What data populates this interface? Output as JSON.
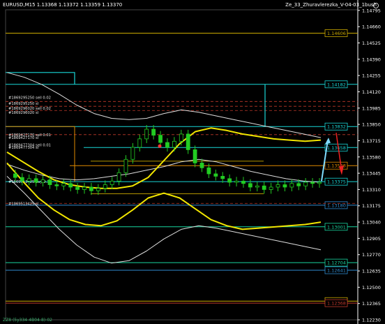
{
  "header": {
    "symbol_line": "EURUSD,M15  1.13368 1.13372 1.13359 1.13370",
    "indicator_name": "Ze_33_Zhuravlerezka_V-04-03_1bush"
  },
  "footer": {
    "text": "ZZ8 (5y334-4B04-8)-02"
  },
  "colors": {
    "background": "#000000",
    "candles": "#22cc22",
    "price_axis": "#ffffff",
    "cyan_level": "#19d7d7",
    "gold_level": "#ccaa00",
    "orange_level": "#e08a00",
    "yellow_band": "#f2e600",
    "white_band": "#dddddd",
    "red_dash": "#c0392b"
  },
  "chart_data": {
    "type": "line",
    "symbol": "EURUSD",
    "timeframe": "M15",
    "ohlc": {
      "open": 1.13368,
      "high": 1.13372,
      "low": 1.13359,
      "close": 1.1337
    },
    "ylim": [
      1.1223,
      1.148
    ],
    "price_axis_ticks": [
      "1.14795",
      "1.14660",
      "1.14525",
      "1.14390",
      "1.14255",
      "1.14120",
      "1.13985",
      "1.13850",
      "1.13715",
      "1.13580",
      "1.13445",
      "1.13310",
      "1.13175",
      "1.13040",
      "1.12905",
      "1.12770",
      "1.12635",
      "1.12500",
      "1.12365",
      "1.12230"
    ],
    "horizontal_levels": [
      {
        "label": "1.14606",
        "price": 1.14606,
        "style": "gold"
      },
      {
        "label": "1.14182",
        "price": 1.14182,
        "style": "cyan"
      },
      {
        "label": "1.13832",
        "price": 1.13832,
        "style": "cyan"
      },
      {
        "label": "1.13658",
        "price": 1.13658,
        "style": "cyan-box"
      },
      {
        "label": "1.13508",
        "price": 1.13508,
        "style": "orange"
      },
      {
        "label": "1.13375",
        "price": 1.13375,
        "style": "cyan"
      },
      {
        "label": "1.13180",
        "price": 1.1318,
        "style": "blue"
      },
      {
        "label": "1.13001",
        "price": 1.13001,
        "style": "green"
      },
      {
        "label": "1.12704",
        "price": 1.12704,
        "style": "green"
      },
      {
        "label": "1.12641",
        "price": 1.12641,
        "style": "blue"
      },
      {
        "label": "1.12385",
        "price": 1.12385,
        "style": "gold"
      },
      {
        "label": "1.12368",
        "price": 1.12368,
        "style": "red"
      }
    ],
    "order_labels": [
      {
        "text": "#1869295250 sell 0.02",
        "price": 1.14075
      },
      {
        "text": "#1869295250 sl",
        "price": 1.14025
      },
      {
        "text": "#1869296020 sell 0.02",
        "price": 1.13985
      },
      {
        "text": "#1869296020 sl",
        "price": 1.1395
      },
      {
        "text": "#1869427170 sell 0.01",
        "price": 1.13765
      },
      {
        "text": "#1869427170 sl",
        "price": 1.1374
      },
      {
        "text": "#1869477304 sell 0.01",
        "price": 1.1368
      },
      {
        "text": "#1869477304 sl",
        "price": 1.1366
      },
      {
        "text": "#1869513425 buy 0.30",
        "price": 1.13375
      },
      {
        "text": "#1869513425 sl",
        "price": 1.13195
      }
    ],
    "price_series": [
      1.1344,
      1.1341,
      1.1338,
      1.134,
      1.1337,
      1.1339,
      1.1335,
      1.1334,
      1.1336,
      1.1333,
      1.1331,
      1.1333,
      1.133,
      1.1332,
      1.1335,
      1.1338,
      1.1345,
      1.1356,
      1.1366,
      1.1373,
      1.1381,
      1.1376,
      1.137,
      1.1366,
      1.1371,
      1.1377,
      1.1364,
      1.1353,
      1.1349,
      1.1344,
      1.1342,
      1.134,
      1.1337,
      1.1338,
      1.1336,
      1.1333,
      1.1334,
      1.1331,
      1.1333,
      1.1335,
      1.1333,
      1.1336,
      1.1334,
      1.1337,
      1.1336,
      1.1337
    ],
    "yellow_upper": [
      1.1362,
      1.1354,
      1.1346,
      1.1339,
      1.1335,
      1.1333,
      1.1332,
      1.1332,
      1.1334,
      1.1341,
      1.1355,
      1.1369,
      1.1379,
      1.1382,
      1.138,
      1.1377,
      1.1375,
      1.1373,
      1.1372,
      1.1371,
      1.1372
    ],
    "yellow_lower": [
      1.1353,
      1.1338,
      1.1324,
      1.1314,
      1.1306,
      1.1302,
      1.1301,
      1.1305,
      1.1314,
      1.1324,
      1.1328,
      1.1324,
      1.1315,
      1.1306,
      1.1301,
      1.1298,
      1.1299,
      1.13,
      1.1301,
      1.1302,
      1.1304
    ],
    "white_upper": [
      1.1428,
      1.1424,
      1.1418,
      1.141,
      1.1401,
      1.1394,
      1.139,
      1.1389,
      1.139,
      1.1394,
      1.1397,
      1.1395,
      1.1392,
      1.1389,
      1.1386,
      1.1383,
      1.138,
      1.1377,
      1.1374
    ],
    "white_mid": [
      1.1352,
      1.1347,
      1.1343,
      1.134,
      1.1339,
      1.134,
      1.1342,
      1.1344,
      1.1347,
      1.135,
      1.1354,
      1.1356,
      1.1354,
      1.135,
      1.1346,
      1.1343,
      1.134,
      1.1338,
      1.1337
    ],
    "white_lower": [
      1.1342,
      1.1328,
      1.1313,
      1.1298,
      1.1285,
      1.1275,
      1.127,
      1.1272,
      1.128,
      1.129,
      1.1298,
      1.1301,
      1.1299,
      1.1296,
      1.1293,
      1.129,
      1.1287,
      1.1284,
      1.1281
    ],
    "grid": false
  }
}
